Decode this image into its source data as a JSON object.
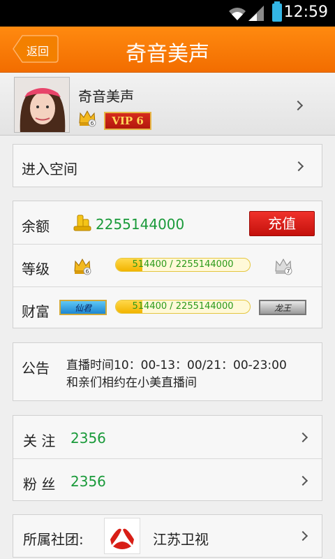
{
  "status_bar": {
    "time": "12:59"
  },
  "header": {
    "back_label": "返回",
    "title": "奇音美声"
  },
  "profile": {
    "name": "奇音美声",
    "vip_label": "VIP 6",
    "crown_level": "6"
  },
  "enter_space": {
    "label": "进入空间"
  },
  "balance": {
    "label": "余额",
    "value": "2255144000",
    "recharge_label": "充值"
  },
  "level": {
    "label": "等级",
    "progress_text": "514400 / 2255144000",
    "progress_fraction": 0.2,
    "current_level": "6",
    "next_level": "7"
  },
  "wealth": {
    "label": "财富",
    "progress_text": "514400 / 2255144000",
    "progress_fraction": 0.2,
    "current_title": "仙君",
    "next_title": "龙王"
  },
  "notice": {
    "label": "公告",
    "line1": "直播时间10：00-13：00/21：00-23:00",
    "line2": "和亲们相约在小美直播间"
  },
  "follow": {
    "label": "关 注",
    "count": "2356"
  },
  "fans": {
    "label": "粉 丝",
    "count": "2356"
  },
  "club": {
    "label": "所属社团:",
    "name": "江苏卫视"
  },
  "colors": {
    "accent": "#f57a00",
    "number_green": "#1a9a3a",
    "recharge_red": "#d81e16"
  },
  "icons": [
    "wifi-icon",
    "signal-icon",
    "battery-icon",
    "crown-icon",
    "gold-coins-icon",
    "chevron-right-icon",
    "club-logo-icon"
  ]
}
